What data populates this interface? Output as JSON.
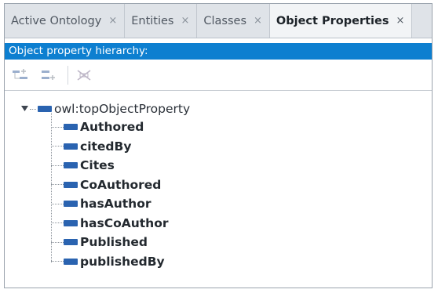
{
  "tabs": [
    {
      "label": "Active Ontology",
      "close": "×"
    },
    {
      "label": "Entities",
      "close": "×"
    },
    {
      "label": "Classes",
      "close": "×"
    },
    {
      "label": "Object Properties",
      "close": "×",
      "active": true
    }
  ],
  "view": {
    "title": "Object property hierarchy:"
  },
  "toolbar": {
    "icons": [
      "add-sub-property-icon",
      "add-sibling-property-icon",
      "delete-property-icon"
    ]
  },
  "tree": {
    "root": "owl:topObjectProperty",
    "children": [
      "Authored",
      "citedBy",
      "Cites",
      "CoAuthored",
      "hasAuthor",
      "hasCoAuthor",
      "Published",
      "publishedBy"
    ]
  },
  "colors": {
    "header_bg": "#0d7fd0",
    "property_icon": "#2a63b0"
  }
}
